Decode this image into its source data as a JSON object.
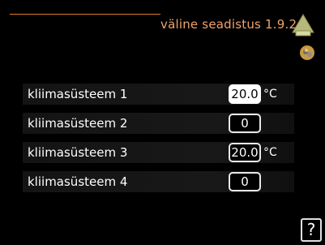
{
  "header": {
    "title": "väline seadistus 1.9.2",
    "accent_color": "#e07a2a"
  },
  "icons": {
    "home": "home-icon",
    "outdoor": "outdoor-sensor-icon",
    "help": "help-icon"
  },
  "rows": [
    {
      "label": "kliimasüsteem 1",
      "value": "20.0",
      "unit": "°C",
      "selected": true
    },
    {
      "label": "kliimasüsteem 2",
      "value": "0",
      "unit": "",
      "selected": false
    },
    {
      "label": "kliimasüsteem 3",
      "value": "20.0",
      "unit": "°C",
      "selected": false
    },
    {
      "label": "kliimasüsteem 4",
      "value": "0",
      "unit": "",
      "selected": false
    }
  ],
  "help": {
    "label": "?"
  }
}
